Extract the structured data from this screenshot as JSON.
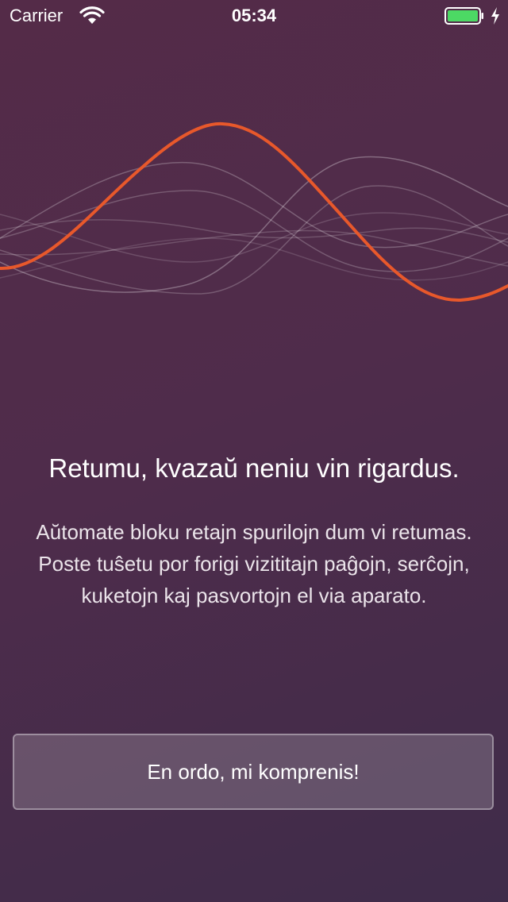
{
  "status_bar": {
    "carrier": "Carrier",
    "time": "05:34",
    "battery_level": 1.0,
    "battery_color": "#4cd964"
  },
  "illustration": {
    "accent_color": "#e8582b",
    "icon": "sound-wave-icon"
  },
  "content": {
    "headline": "Retumu, kvazaŭ neniu vin rigardus.",
    "body": "Aŭtomate bloku retajn spurilojn dum vi retumas. Poste tuŝetu por forigi vizititajn paĝojn, serĉojn, kuketojn kaj pasvortojn el via aparato."
  },
  "actions": {
    "confirm_label": "En ordo, mi komprenis!"
  }
}
